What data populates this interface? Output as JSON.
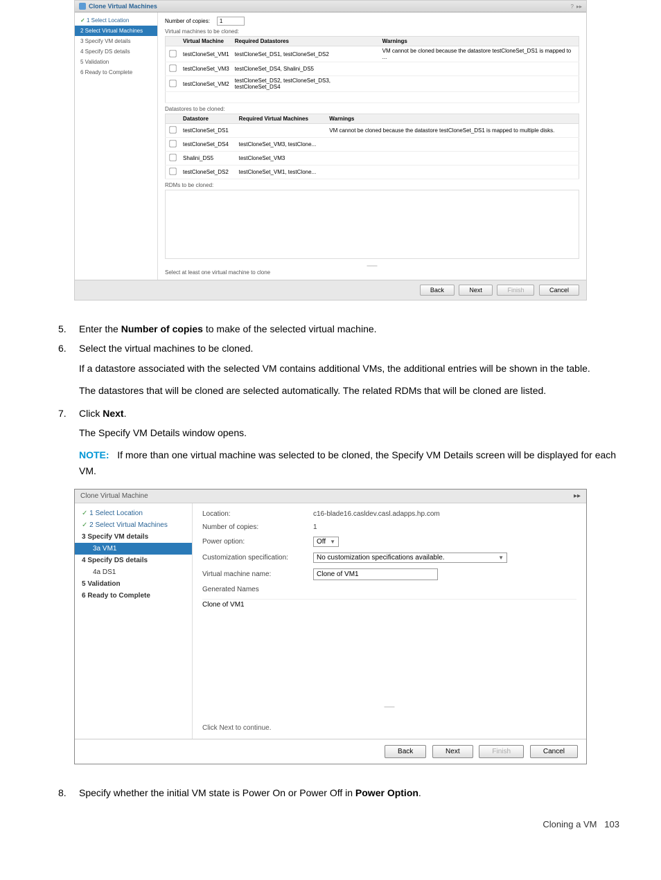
{
  "screenshot1": {
    "title": "Clone Virtual Machines",
    "steps": [
      {
        "label": "1 Select Location",
        "class": "complete"
      },
      {
        "label": "2 Select Virtual Machines",
        "class": "active"
      },
      {
        "label": "3 Specify VM details",
        "class": ""
      },
      {
        "label": "4 Specify DS details",
        "class": ""
      },
      {
        "label": "5 Validation",
        "class": ""
      },
      {
        "label": "6 Ready to Complete",
        "class": ""
      }
    ],
    "num_copies_label": "Number of copies:",
    "num_copies_value": "1",
    "vm_table_label": "Virtual machines to be cloned:",
    "vm_table": {
      "headers": [
        "",
        "Virtual Machine",
        "Required Datastores",
        "Warnings"
      ],
      "rows": [
        {
          "vm": "testCloneSet_VM1",
          "ds": "testCloneSet_DS1, testCloneSet_DS2",
          "warn": "VM cannot be cloned because the datastore testCloneSet_DS1 is mapped to ..."
        },
        {
          "vm": "testCloneSet_VM3",
          "ds": "testCloneSet_DS4, Shalini_DS5",
          "warn": ""
        },
        {
          "vm": "testCloneSet_VM2",
          "ds": "testCloneSet_DS2, testCloneSet_DS3, testCloneSet_DS4",
          "warn": ""
        }
      ]
    },
    "ds_table_label": "Datastores to be cloned:",
    "ds_table": {
      "headers": [
        "",
        "Datastore",
        "Required Virtual Machines",
        "Warnings"
      ],
      "rows": [
        {
          "ds": "testCloneSet_DS1",
          "vm": "",
          "warn": "VM cannot be cloned because the datastore testCloneSet_DS1 is mapped to multiple disks."
        },
        {
          "ds": "testCloneSet_DS4",
          "vm": "testCloneSet_VM3, testClone...",
          "warn": ""
        },
        {
          "ds": "Shalini_DS5",
          "vm": "testCloneSet_VM3",
          "warn": ""
        },
        {
          "ds": "testCloneSet_DS2",
          "vm": "testCloneSet_VM1, testClone...",
          "warn": ""
        }
      ]
    },
    "rdm_label": "RDMs to be cloned:",
    "validation_msg": "Select at least one virtual machine to clone",
    "buttons": {
      "back": "Back",
      "next": "Next",
      "finish": "Finish",
      "cancel": "Cancel"
    }
  },
  "body": {
    "step5_num": "5.",
    "step5_text_a": "Enter the ",
    "step5_text_b": "Number of copies",
    "step5_text_c": " to make of the selected virtual machine.",
    "step6_num": "6.",
    "step6_text": "Select the virtual machines to be cloned.",
    "step6_para1": "If a datastore associated with the selected VM contains additional VMs, the additional entries will be shown in the table.",
    "step6_para2": "The datastores that will be cloned are selected automatically. The related RDMs that will be cloned are listed.",
    "step7_num": "7.",
    "step7_text_a": "Click ",
    "step7_text_b": "Next",
    "step7_text_c": ".",
    "step7_para1": "The Specify VM Details window opens.",
    "note_label": "NOTE:",
    "note_text": "If more than one virtual machine was selected to be cloned, the Specify VM Details screen will be displayed for each VM.",
    "step8_num": "8.",
    "step8_text_a": "Specify whether the initial VM state is Power On or Power Off in ",
    "step8_text_b": "Power Option",
    "step8_text_c": "."
  },
  "screenshot2": {
    "title": "Clone Virtual Machine",
    "steps": [
      {
        "label": "1 Select Location",
        "class": "complete"
      },
      {
        "label": "2 Select Virtual Machines",
        "class": "complete"
      },
      {
        "label": "3 Specify VM details",
        "class": "bold"
      },
      {
        "label": "3a VM1",
        "class": "active"
      },
      {
        "label": "4 Specify DS details",
        "class": "bold"
      },
      {
        "label": "4a DS1",
        "class": "sub"
      },
      {
        "label": "5 Validation",
        "class": "bold"
      },
      {
        "label": "6 Ready to Complete",
        "class": "bold"
      }
    ],
    "location_label": "Location:",
    "location_value": "c16-blade16.casldev.casl.adapps.hp.com",
    "copies_label": "Number of copies:",
    "copies_value": "1",
    "power_label": "Power option:",
    "power_value": "Off",
    "custom_label": "Customization specification:",
    "custom_value": "No customization specifications available.",
    "vmname_label": "Virtual machine name:",
    "vmname_value": "Clone of VM1",
    "generated_label": "Generated Names",
    "generated_value": "Clone of VM1",
    "continue_text": "Click Next to continue.",
    "buttons": {
      "back": "Back",
      "next": "Next",
      "finish": "Finish",
      "cancel": "Cancel"
    }
  },
  "footer": {
    "text": "Cloning a VM",
    "page": "103"
  }
}
